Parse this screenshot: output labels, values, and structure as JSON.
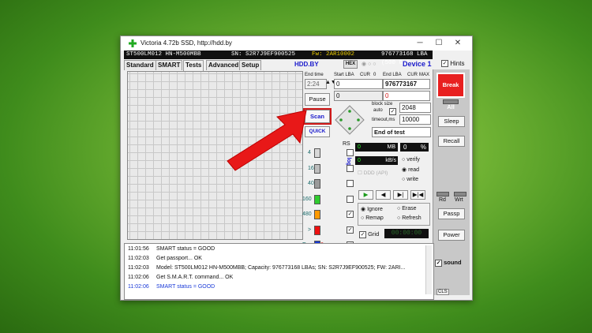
{
  "window": {
    "title": "Victoria 4.72b SSD, http://hdd.by",
    "min": "─",
    "max": "☐",
    "close": "✕"
  },
  "infobar": {
    "model": "ST500LM012 HN-M500MBB",
    "sn": "SN: S2R7J9EF900525",
    "fw": "Fw: 2AR10002",
    "lba": "976773168 LBA (500 Gb)"
  },
  "tabs": [
    "Standard",
    "SMART",
    "Tests",
    "Advanced",
    "Setup"
  ],
  "hdd_by": "HDD.BY",
  "hex": "HEX",
  "device": "Device 1",
  "hints": "Hints",
  "endtime": {
    "label": "End time",
    "value": "2:24"
  },
  "startlba": {
    "label": "Start LBA",
    "cur": "CUR",
    "max": "0",
    "value": "0",
    "current": "0"
  },
  "endlba": {
    "label": "End LBA",
    "cur": "CUR",
    "max": "MAX",
    "value": "976773167",
    "current": "0"
  },
  "buttons": {
    "pause": "Pause",
    "scan": "Scan",
    "quick": "QUICK",
    "break_all": "Break All",
    "sleep": "Sleep",
    "recall": "Recall",
    "passp": "Passp",
    "power": "Power",
    "cls": "CLS"
  },
  "blocksize": {
    "label": "block size",
    "auto": "auto",
    "value": "2048"
  },
  "timeout": {
    "label": "timeout,ms",
    "value": "10000"
  },
  "endoftest": "End of test",
  "rs": "RS",
  "tolog": "to log:",
  "blocks": [
    {
      "label": "4",
      "color": "#d8d8d8"
    },
    {
      "label": "16",
      "color": "#bdbdbd"
    },
    {
      "label": "40",
      "color": "#9a9a9a"
    },
    {
      "label": "160",
      "color": "#2fcc2f"
    },
    {
      "label": "480",
      "color": "#ff9a00"
    },
    {
      "label": ">",
      "color": "#e11"
    },
    {
      "label": "Err",
      "color": "#1a3ad8"
    }
  ],
  "err_count": "0",
  "stats": {
    "mb_label": "MB",
    "mb": "0",
    "pct": "0",
    "pct_label": "%",
    "kbs_label": "kB/s",
    "kbs": "0"
  },
  "verify": "verify",
  "read": "read",
  "write": "write",
  "ddd": "DDD (API)",
  "options": {
    "ignore": "Ignore",
    "erase": "Erase",
    "remap": "Remap",
    "refresh": "Refresh"
  },
  "grid_label": "Grid",
  "timer": "00:00:00",
  "rd": "Rd",
  "wrt": "Wrt",
  "sound": "sound",
  "log": [
    {
      "time": "11:01:56",
      "text": "SMART status = GOOD",
      "color": "#111"
    },
    {
      "time": "11:02:03",
      "text": "Get passport... OK",
      "color": "#111"
    },
    {
      "time": "11:02:03",
      "text": "Model: ST500LM012 HN-M500MBB; Capacity: 976773168 LBAs; SN: S2R7J9EF900525; FW: 2ARI...",
      "color": "#111"
    },
    {
      "time": "11:02:06",
      "text": "Get S.M.A.R.T. command... OK",
      "color": "#111"
    },
    {
      "time": "11:02:06",
      "text": "SMART status = GOOD",
      "color": "#1a3ad8"
    }
  ]
}
